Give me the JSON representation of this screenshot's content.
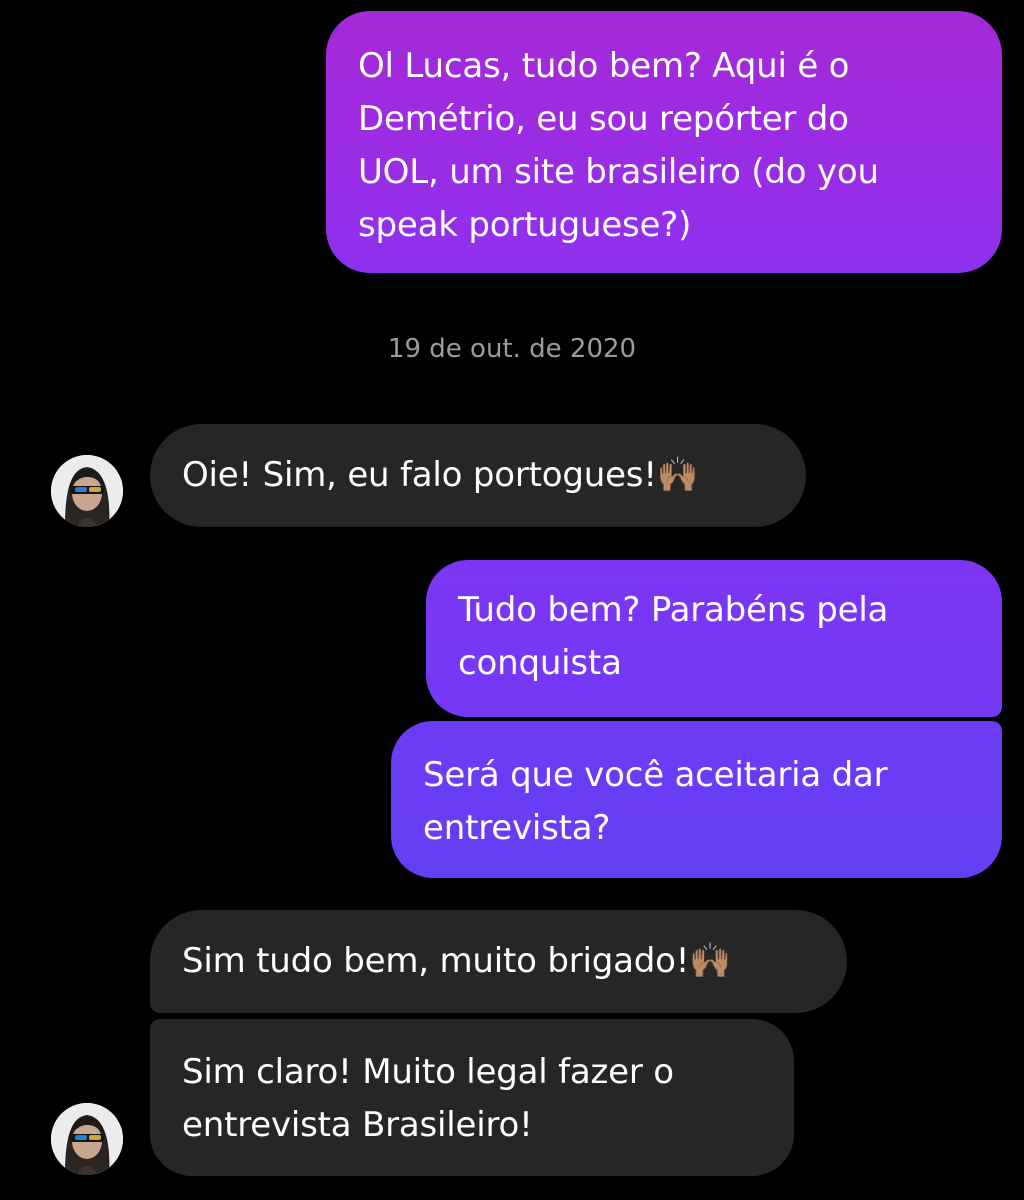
{
  "conversation": {
    "messages": [
      {
        "sender": "me",
        "text": "Ol Lucas, tudo bem? Aqui é o\nDemétrio, eu sou repórter do\nUOL, um site brasileiro (do you\nspeak portuguese?)"
      },
      {
        "sender": "them",
        "text": "Oie! Sim, eu falo portogues!🙌🏽"
      },
      {
        "sender": "me",
        "text": "Tudo bem? Parabéns pela\nconquista"
      },
      {
        "sender": "me",
        "text": "Será que você aceitaria dar\nentrevista?"
      },
      {
        "sender": "them",
        "text": "Sim tudo bem, muito brigado!🙌🏽"
      },
      {
        "sender": "them",
        "text": "Sim claro! Muito legal fazer o\nentrevista Brasileiro!"
      }
    ],
    "date_divider": "19 de out. de 2020",
    "avatar_icon": "user-avatar-photo",
    "colors": {
      "background": "#000000",
      "received_bubble": "#262626",
      "sent_bubble_top": "#a42ad7",
      "sent_bubble_bottom": "#643ff5",
      "date_text": "#9c9c9c"
    }
  }
}
